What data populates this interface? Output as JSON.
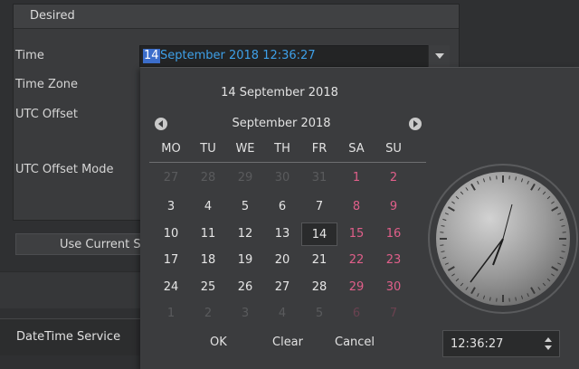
{
  "panel": {
    "title": "Desired",
    "rows": {
      "time": "Time",
      "time_zone": "Time Zone",
      "utc_offset": "UTC Offset",
      "utc_offset_mode": "UTC Offset Mode"
    },
    "time_value_selected": "14",
    "time_value_rest": "September 2018 12:36:27",
    "use_current_button": "Use Current S"
  },
  "service_tab": "DateTime Service",
  "picker": {
    "selected_date": "14 September 2018",
    "month_label": "September 2018",
    "weekdays": [
      "MO",
      "TU",
      "WE",
      "TH",
      "FR",
      "SA",
      "SU"
    ],
    "weeks": [
      [
        "27",
        "28",
        "29",
        "30",
        "31",
        "1",
        "2"
      ],
      [
        "3",
        "4",
        "5",
        "6",
        "7",
        "8",
        "9"
      ],
      [
        "10",
        "11",
        "12",
        "13",
        "14",
        "15",
        "16"
      ],
      [
        "17",
        "18",
        "19",
        "20",
        "21",
        "22",
        "23"
      ],
      [
        "24",
        "25",
        "26",
        "27",
        "28",
        "29",
        "30"
      ],
      [
        "1",
        "2",
        "3",
        "4",
        "5",
        "6",
        "7"
      ]
    ],
    "selected_day": "14",
    "ok_label": "OK",
    "clear_label": "Clear",
    "cancel_label": "Cancel",
    "time_value": "12:36:27"
  },
  "colors": {
    "background": "#2f3032",
    "accent_text": "#3ea0e8",
    "selection": "#3c6ecb",
    "weekend": "#e05f8a"
  }
}
